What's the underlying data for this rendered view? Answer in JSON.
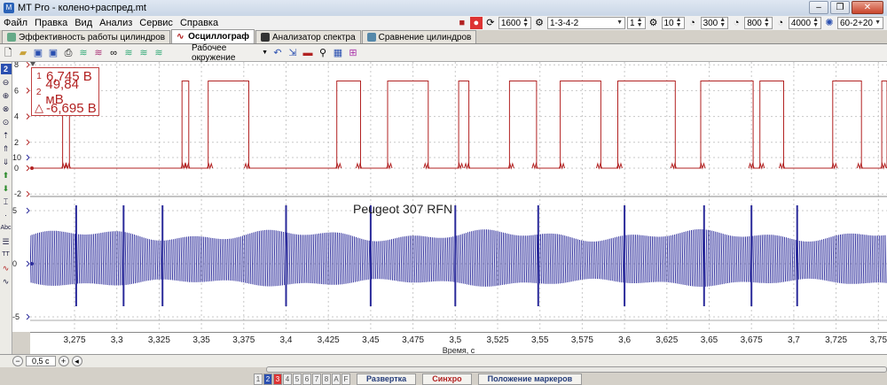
{
  "window": {
    "title": "MT Pro - колено+распред.mt"
  },
  "menu": [
    "Файл",
    "Правка",
    "Вид",
    "Анализ",
    "Сервис",
    "Справка"
  ],
  "toolbar_right": {
    "rpm": "1600",
    "firing_order": "1-3-4-2",
    "cyl": "1",
    "teeth": "10",
    "v1": "300",
    "v2": "800",
    "v3": "4000",
    "wheel": "60-2+20"
  },
  "tabs": [
    {
      "label": "Эффективность работы цилиндров",
      "active": false
    },
    {
      "label": "Осциллограф",
      "active": true
    },
    {
      "label": "Анализатор спектра",
      "active": false
    },
    {
      "label": "Сравнение цилиндров",
      "active": false
    }
  ],
  "toolbar2": {
    "environment": "Рабочее окружение"
  },
  "left_tools": {
    "channel_badge": "2"
  },
  "readout": {
    "m1_marker": "1",
    "m1_value": "6,745 В",
    "m2_marker": "2",
    "m2_value": "49,84 мВ",
    "delta_marker": "△",
    "delta_value": "-6,695 В"
  },
  "annotation": "Peugeot 307 RFN",
  "y_ticks_ch1": [
    "8",
    "6",
    "4",
    "2",
    "0",
    "-2"
  ],
  "y_ticks_ch2": [
    "10",
    "5",
    "0",
    "-5"
  ],
  "x_ticks": [
    "3,275",
    "3,3",
    "3,325",
    "3,35",
    "3,375",
    "3,4",
    "3,425",
    "3,45",
    "3,475",
    "3,5",
    "3,525",
    "3,55",
    "3,575",
    "3,6",
    "3,625",
    "3,65",
    "3,675",
    "3,7",
    "3,725",
    "3,75"
  ],
  "x_label": "Время, с",
  "bottom": {
    "timebase": "0,5 с"
  },
  "status": {
    "pages": [
      "1",
      "2",
      "3",
      "4",
      "5",
      "6",
      "7",
      "8",
      "A",
      "F"
    ],
    "sweep": "Развертка",
    "sync": "Синхро",
    "markers": "Положение маркеров"
  },
  "colors": {
    "ch1": "#b22222",
    "ch2": "#2a2a9a",
    "grid": "#c8c8c8"
  }
}
